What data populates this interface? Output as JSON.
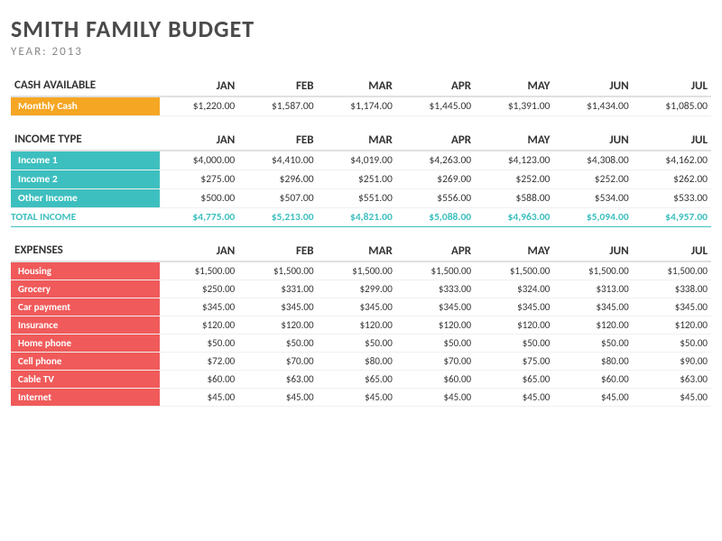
{
  "title": "SMITH FAMILY BUDGET",
  "year_label": "YEAR: 2013",
  "sections": {
    "cash_available": {
      "header": "CASH AVAILABLE",
      "months": [
        "JAN",
        "FEB",
        "MAR",
        "APR",
        "MAY",
        "JUN",
        "JUL"
      ],
      "rows": [
        {
          "label": "Monthly Cash",
          "values": [
            "$1,220.00",
            "$1,587.00",
            "$1,174.00",
            "$1,445.00",
            "$1,391.00",
            "$1,434.00",
            "$1,085.00"
          ]
        }
      ]
    },
    "income": {
      "header": "INCOME TYPE",
      "months": [
        "JAN",
        "FEB",
        "MAR",
        "APR",
        "MAY",
        "JUN",
        "JUL"
      ],
      "rows": [
        {
          "label": "Income 1",
          "values": [
            "$4,000.00",
            "$4,410.00",
            "$4,019.00",
            "$4,263.00",
            "$4,123.00",
            "$4,308.00",
            "$4,162.00"
          ]
        },
        {
          "label": "Income 2",
          "values": [
            "$275.00",
            "$296.00",
            "$251.00",
            "$269.00",
            "$252.00",
            "$252.00",
            "$262.00"
          ]
        },
        {
          "label": "Other Income",
          "values": [
            "$500.00",
            "$507.00",
            "$551.00",
            "$556.00",
            "$588.00",
            "$534.00",
            "$533.00"
          ]
        }
      ],
      "total_label": "TOTAL INCOME",
      "total_values": [
        "$4,775.00",
        "$5,213.00",
        "$4,821.00",
        "$5,088.00",
        "$4,963.00",
        "$5,094.00",
        "$4,957.00"
      ]
    },
    "expenses": {
      "header": "EXPENSES",
      "months": [
        "JAN",
        "FEB",
        "MAR",
        "APR",
        "MAY",
        "JUN",
        "JUL"
      ],
      "rows": [
        {
          "label": "Housing",
          "values": [
            "$1,500.00",
            "$1,500.00",
            "$1,500.00",
            "$1,500.00",
            "$1,500.00",
            "$1,500.00",
            "$1,500.00"
          ]
        },
        {
          "label": "Grocery",
          "values": [
            "$250.00",
            "$331.00",
            "$299.00",
            "$333.00",
            "$324.00",
            "$313.00",
            "$338.00"
          ]
        },
        {
          "label": "Car payment",
          "values": [
            "$345.00",
            "$345.00",
            "$345.00",
            "$345.00",
            "$345.00",
            "$345.00",
            "$345.00"
          ]
        },
        {
          "label": "Insurance",
          "values": [
            "$120.00",
            "$120.00",
            "$120.00",
            "$120.00",
            "$120.00",
            "$120.00",
            "$120.00"
          ]
        },
        {
          "label": "Home phone",
          "values": [
            "$50.00",
            "$50.00",
            "$50.00",
            "$50.00",
            "$50.00",
            "$50.00",
            "$50.00"
          ]
        },
        {
          "label": "Cell phone",
          "values": [
            "$72.00",
            "$70.00",
            "$80.00",
            "$70.00",
            "$75.00",
            "$80.00",
            "$90.00"
          ]
        },
        {
          "label": "Cable TV",
          "values": [
            "$60.00",
            "$63.00",
            "$65.00",
            "$60.00",
            "$65.00",
            "$60.00",
            "$63.00"
          ]
        },
        {
          "label": "Internet",
          "values": [
            "$45.00",
            "$45.00",
            "$45.00",
            "$45.00",
            "$45.00",
            "$45.00",
            "$45.00"
          ]
        }
      ]
    }
  }
}
